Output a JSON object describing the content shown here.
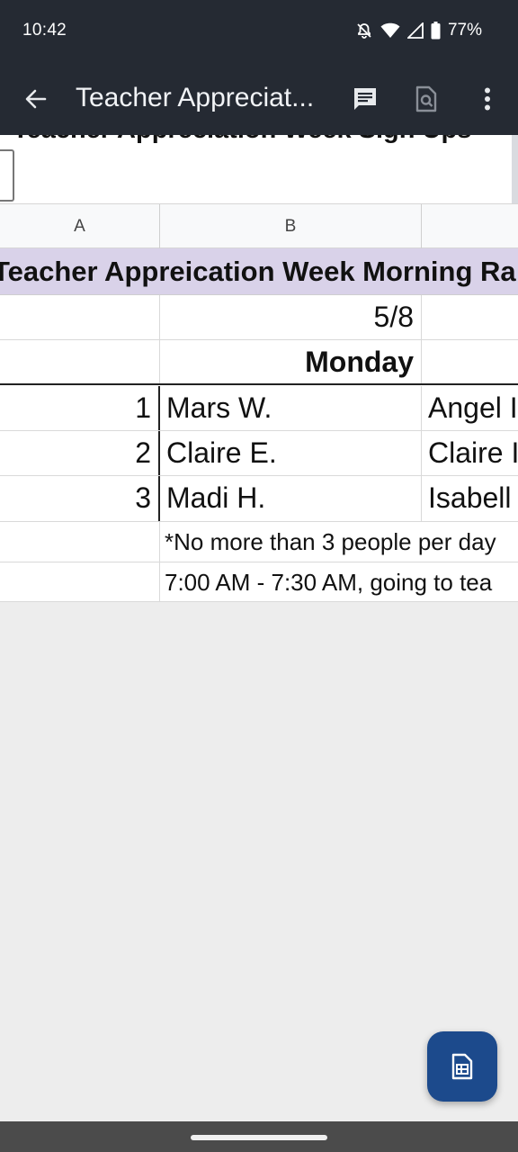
{
  "status_bar": {
    "time": "10:42",
    "battery": "77%"
  },
  "app_bar": {
    "title": "Teacher Appreciat..."
  },
  "sheet": {
    "doc_title": "Teacher Appreciation Week Sign Ups",
    "columns": [
      "A",
      "B"
    ],
    "banner": "Teacher Appreication Week Morning Ra",
    "date_row": {
      "b": "5/8"
    },
    "day_row": {
      "b": "Monday"
    },
    "slots": [
      {
        "num": "1",
        "b": "Mars W.",
        "c": "Angel I"
      },
      {
        "num": "2",
        "b": "Claire E.",
        "c": "Claire I"
      },
      {
        "num": "3",
        "b": "Madi H.",
        "c": "Isabell"
      }
    ],
    "note": "*No more than 3 people per day",
    "time_note": "7:00 AM - 7:30 AM, going to tea"
  },
  "colors": {
    "banner_bg": "#d9d2e9",
    "app_bar_bg": "#252a33",
    "fab_bg": "#1c4a8c"
  }
}
